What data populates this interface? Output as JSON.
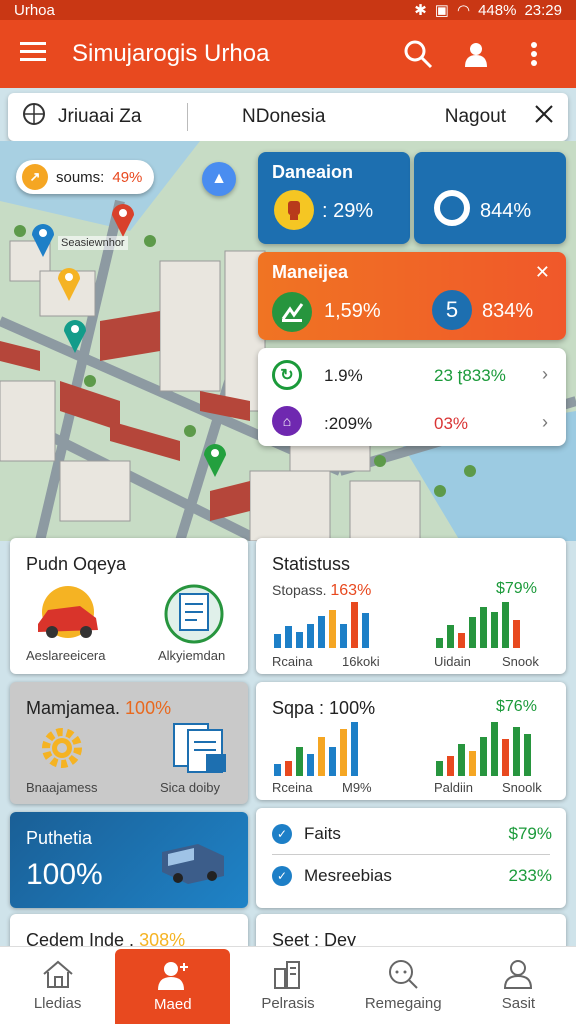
{
  "status_bar": {
    "carrier": "Urhoa",
    "battery": "448%",
    "time": "23:29"
  },
  "app_bar": {
    "title": "Simujarogis Urhoa"
  },
  "search": {
    "location": "Jriuaai Za",
    "country": "NDonesia",
    "extra": "Nagout"
  },
  "map": {
    "chip_label": "soums:",
    "chip_value": "49%",
    "map_label": "Seasiewnhor"
  },
  "overlays": {
    "blue_card": {
      "title": "Daneaion",
      "value_left": ": 29%",
      "value_right": "844%"
    },
    "orange_card": {
      "title": "Maneijea",
      "value_left": "1,59%",
      "badge": "5",
      "value_right": "834%"
    },
    "list_rows": [
      {
        "value": "1.9%",
        "right_value": "23 ʈ833%",
        "right_color": "#1b9a3a"
      },
      {
        "value": ":209%",
        "right_value": "03%",
        "right_color": "#d93434"
      }
    ]
  },
  "cards": {
    "pudn": {
      "title": "Pudn Oqeya",
      "left_caption": "Aeslareeicera",
      "right_caption": "Alkyiemdan"
    },
    "statistics": {
      "title": "Statistuss",
      "sub_left": "Stopass.",
      "sub_left_value": "163%",
      "sub_right_value": "$79%",
      "caption_left_a": "Rcaina",
      "caption_left_b": "16koki",
      "caption_right_a": "Uidain",
      "caption_right_b": "Snook"
    },
    "management": {
      "title": "Mamjamea.",
      "value": "100%",
      "caption_left": "Bnaajamess",
      "caption_right": "Sica doiby"
    },
    "sqpa": {
      "title": "Sqpa : 100%",
      "right_value": "$76%",
      "caption_left_a": "Rceina",
      "caption_left_b": "M9%",
      "caption_right_a": "Paldiin",
      "caption_right_b": "Snoolk"
    },
    "puthetia": {
      "title": "Puthetia",
      "value": "100%"
    },
    "checklist": [
      {
        "label": "Faits",
        "value": "$79%"
      },
      {
        "label": "Mesreebias",
        "value": "233%"
      }
    ],
    "cedem": {
      "title": "Cedem Inde .",
      "value": "308%"
    },
    "seet": {
      "title": "Seet : Dey"
    }
  },
  "colors": {
    "accent": "#e8491f",
    "blue": "#1d6fb0",
    "green": "#1b9a3a",
    "orange_text": "#e8691f"
  },
  "chart_data": [
    {
      "type": "bar",
      "title": "",
      "series": [
        {
          "values": [
            5,
            8,
            6,
            9,
            12,
            14,
            9,
            17,
            13
          ]
        },
        {
          "values": [
            4,
            9,
            6,
            12,
            16,
            14,
            18,
            11
          ]
        }
      ]
    },
    {
      "type": "bar",
      "title": "",
      "series": [
        {
          "values": [
            5,
            6,
            12,
            9,
            16,
            12,
            19,
            22
          ]
        },
        {
          "values": [
            6,
            8,
            13,
            10,
            16,
            22,
            15,
            20,
            17
          ]
        }
      ]
    }
  ],
  "bottom_nav": [
    {
      "label": "Lledias",
      "icon": "home-icon"
    },
    {
      "label": "Maed",
      "icon": "user-add-icon"
    },
    {
      "label": "Pelrasis",
      "icon": "building-icon"
    },
    {
      "label": "Remegaing",
      "icon": "chat-search-icon"
    },
    {
      "label": "Sasit",
      "icon": "person-icon"
    }
  ]
}
